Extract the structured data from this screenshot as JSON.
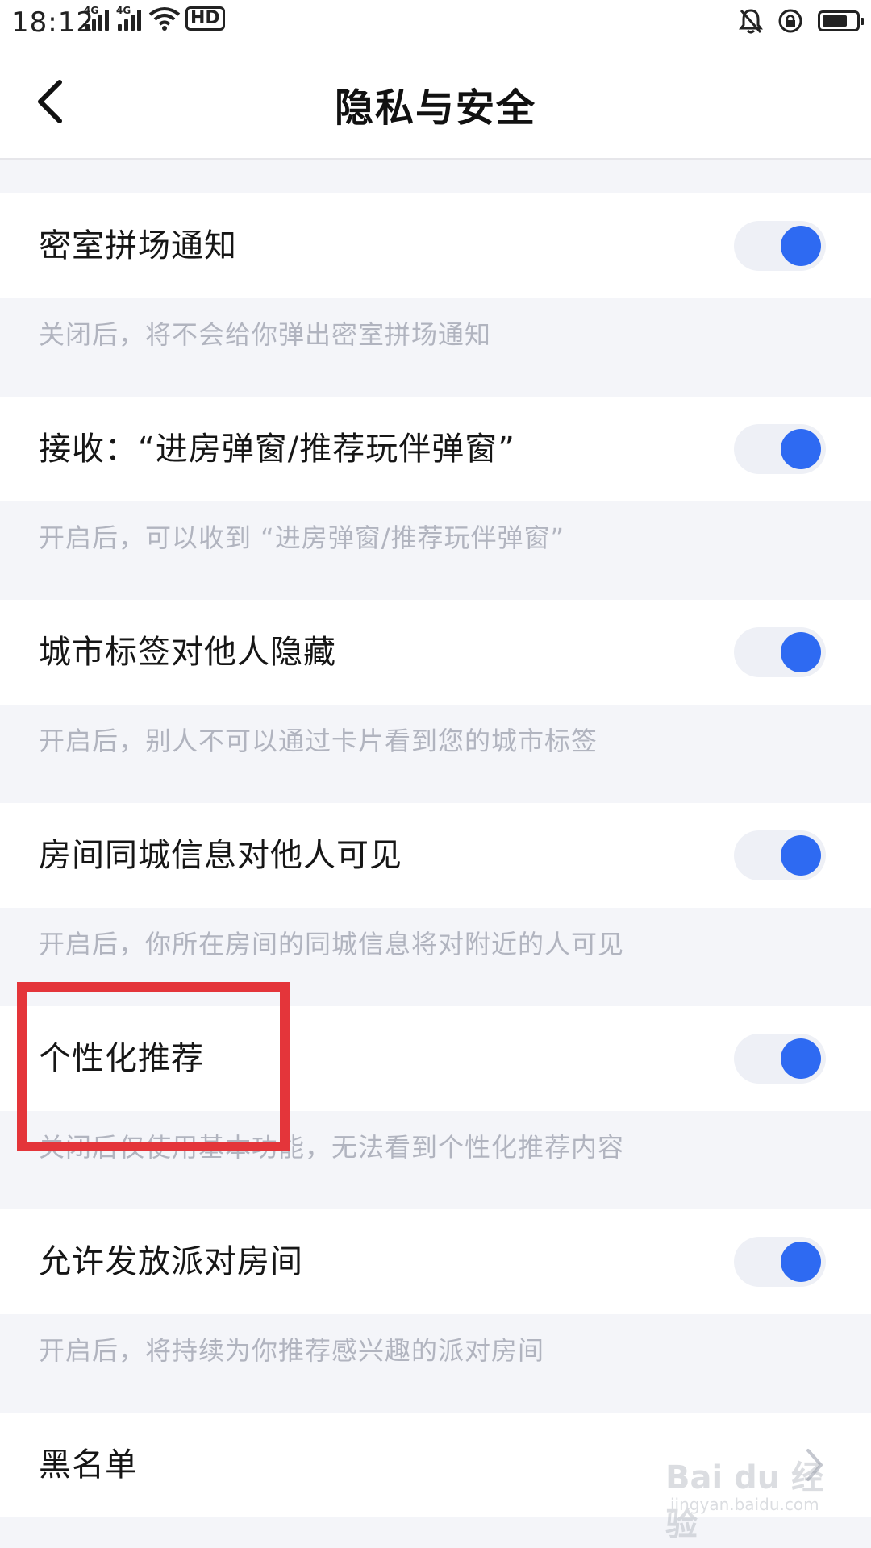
{
  "status_bar": {
    "time": "18:12",
    "network_tag_1": "4G",
    "network_tag_2": "4G",
    "hd_label": "HD",
    "icons": [
      "signal-icon",
      "signal-icon",
      "wifi-icon",
      "hd-icon",
      "mute-bell-icon",
      "rotation-lock-icon",
      "battery-icon"
    ]
  },
  "header": {
    "title": "隐私与安全",
    "back_icon": "chevron-left-icon"
  },
  "settings": [
    {
      "label": "密室拼场通知",
      "description": "关闭后，将不会给你弹出密室拼场通知",
      "toggle_on": true
    },
    {
      "label": "接收：“进房弹窗/推荐玩伴弹窗”",
      "description": "开启后，可以收到 “进房弹窗/推荐玩伴弹窗”",
      "toggle_on": true
    },
    {
      "label": "城市标签对他人隐藏",
      "description": "开启后，别人不可以通过卡片看到您的城市标签",
      "toggle_on": true
    },
    {
      "label": "房间同城信息对他人可见",
      "description": "开启后，你所在房间的同城信息将对附近的人可见",
      "toggle_on": true
    },
    {
      "label": "个性化推荐",
      "description": "关闭后仅使用基本功能，无法看到个性化推荐内容",
      "toggle_on": true
    },
    {
      "label": "允许发放派对房间",
      "description": "开启后，将持续为你推荐感兴趣的派对房间",
      "toggle_on": true
    }
  ],
  "blacklist": {
    "label": "黑名单",
    "icon": "chevron-right-icon"
  },
  "watermark": {
    "main": "Bai du 经验",
    "sub": "jingyan.baidu.com"
  },
  "colors": {
    "accent": "#2e6af2",
    "highlight": "#e4353a",
    "background": "#f4f5f9",
    "description_text": "#b1b4bf"
  }
}
